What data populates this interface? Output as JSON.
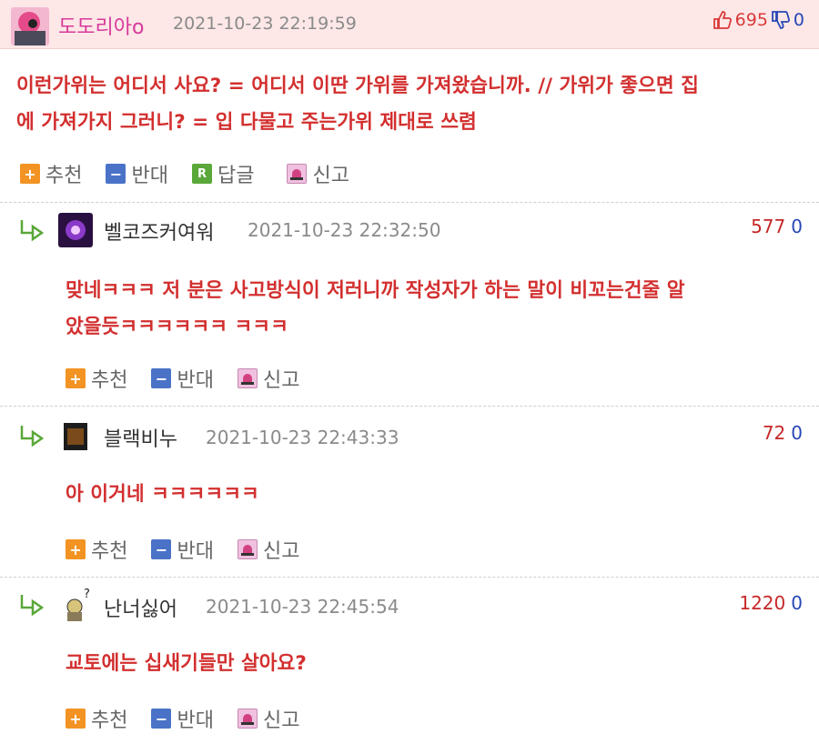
{
  "main_post": {
    "author": "도도리아o",
    "timestamp": "2021-10-23 22:19:59",
    "upvotes": "695",
    "downvotes": "0",
    "text_line1": "이런가위는 어디서 사요? = 어디서 이딴 가위를 가져왔습니까. // 가위가 좋으면 집",
    "text_line2": "에 가져가지 그러니? = 입 다물고 주는가위 제대로 쓰렴",
    "actions": {
      "recommend": "추천",
      "oppose": "반대",
      "reply": "답글",
      "report": "신고"
    }
  },
  "replies": [
    {
      "author": "벨코즈커여워",
      "timestamp": "2021-10-23 22:32:50",
      "upvotes": "577",
      "downvotes": "0",
      "text_line1": "맞네ㅋㅋㅋ 저 분은 사고방식이 저러니까 작성자가 하는 말이 비꼬는건줄 알",
      "text_line2": "았을듯ㅋㅋㅋㅋㅋㅋ ㅋㅋㅋ"
    },
    {
      "author": "블랙비누",
      "timestamp": "2021-10-23 22:43:33",
      "upvotes": "72",
      "downvotes": "0",
      "text_line1": "아 이거네 ㅋㅋㅋㅋㅋㅋ",
      "text_line2": ""
    },
    {
      "author": "난너싫어",
      "timestamp": "2021-10-23 22:45:54",
      "upvotes": "1220",
      "downvotes": "0",
      "text_line1": "교토에는 십새기들만 살아요?",
      "text_line2": ""
    }
  ],
  "reply_actions": {
    "recommend": "추천",
    "oppose": "반대",
    "report": "신고"
  },
  "colors": {
    "header_bg": "#fde7e7",
    "comment_red": "#d32f2f",
    "author_pink": "#d63a9b",
    "up_red": "#c62828",
    "down_blue": "#2747b5"
  },
  "icons": [
    "thumbs-up-icon",
    "thumbs-down-icon",
    "plus-icon",
    "minus-icon",
    "reply-icon",
    "report-icon",
    "reply-arrow-icon"
  ]
}
